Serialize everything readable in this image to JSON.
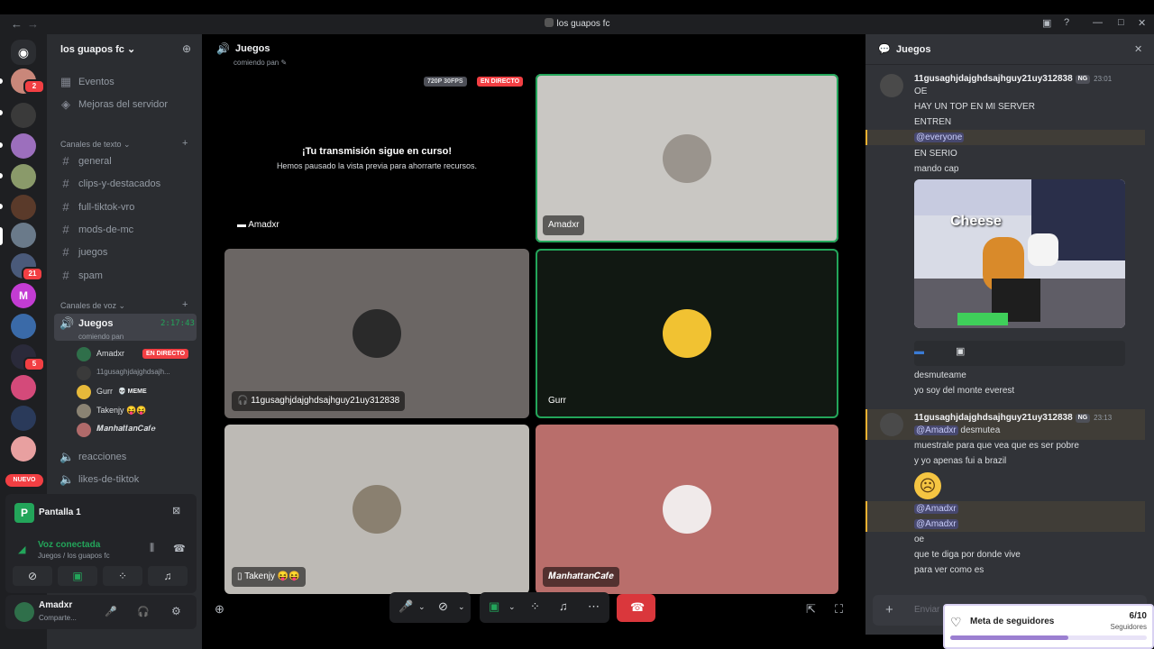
{
  "window": {
    "title": "los guapos fc"
  },
  "rail": {
    "badges": [
      "2",
      "21",
      "5"
    ],
    "nuevo_label": "NUEVO"
  },
  "sidebar": {
    "server_name": "los guapos fc",
    "top_items": [
      {
        "label": "Eventos",
        "icon": "calendar-icon"
      },
      {
        "label": "Mejoras del servidor",
        "icon": "boost-icon"
      }
    ],
    "text_category": "Canales de texto",
    "text_channels": [
      "general",
      "clips-y-destacados",
      "full-tiktok-vro",
      "mods-de-mc",
      "juegos",
      "spam"
    ],
    "voice_category": "Canales de voz",
    "active_voice": {
      "name": "Juegos",
      "status": "comiendo pan",
      "timer": "2:17:43"
    },
    "voice_users": [
      {
        "name": "Amadxr",
        "live": "EN DIRECTO",
        "avatar_color": "#2f6f4a"
      },
      {
        "name": "11gusaghjdajghdsajh...",
        "avatar_color": "#3a3a3a"
      },
      {
        "name": "Gurr",
        "badge": "💀 MEME",
        "avatar_color": "#e6b93a"
      },
      {
        "name": "Takenjy 😝😝",
        "avatar_color": "#8a8373"
      },
      {
        "name": "𝑴𝒂𝒏𝒉𝒂𝒕𝒕𝒂𝒏𝑪𝒂𝒇𝒆",
        "avatar_color": "#b06a6a"
      }
    ],
    "other_voice": [
      "reacciones",
      "likes-de-tiktok"
    ]
  },
  "panel": {
    "screen_label": "Pantalla 1",
    "voice_status": "Voz conectada",
    "voice_location": "Juegos / los guapos fc"
  },
  "userbar": {
    "name": "Amadxr",
    "status": "Comparte..."
  },
  "stage": {
    "title": "Juegos",
    "subtitle": "comiendo pan",
    "stream_quality": "720P 30FPS",
    "live_label": "EN DIRECTO",
    "paused_title": "¡Tu transmisión sigue en curso!",
    "paused_sub": "Hemos pausado la vista previa para ahorrarte recursos.",
    "tiles": [
      {
        "name": "Amadxr",
        "kind": "stream",
        "bg": "#000000"
      },
      {
        "name": "Amadxr",
        "kind": "avatar",
        "bg": "#c9c7c3",
        "avatar": "#9a948d",
        "speaking": true
      },
      {
        "name": "11gusaghjdajghdsajhguy21uy312838",
        "kind": "avatar",
        "bg": "#6b6664",
        "avatar": "#2a2a2a"
      },
      {
        "name": "Gurr",
        "kind": "avatar",
        "bg": "#111812",
        "avatar": "#f1c232",
        "speaking": true
      },
      {
        "name": "Takenjy 😝😝",
        "kind": "avatar",
        "bg": "#bdbab5",
        "avatar": "#8a8070"
      },
      {
        "name": "𝑴𝒂𝒏𝒉𝒂𝒕𝒕𝒂𝒏𝑪𝒂𝒇𝒆",
        "kind": "avatar",
        "bg": "#b96e6b",
        "avatar": "#f0eaea"
      }
    ]
  },
  "chat": {
    "title": "Juegos",
    "msg1": {
      "author": "11gusaghjdajghdsajhguy21uy312838",
      "tag": "NG",
      "time": "23:01",
      "lines": [
        "OE",
        "HAY UN TOP EN MI SERVER",
        "ENTREN"
      ],
      "mention": "@everyone",
      "lines2": [
        "EN SERIO",
        "mando cap"
      ]
    },
    "image_caption": "Cheese",
    "lines3": [
      "desmuteame",
      "yo soy del monte everest"
    ],
    "msg2": {
      "author": "11gusaghjdajghdsajhguy21uy312838",
      "tag": "NG",
      "time": "23:13",
      "mention": "@Amadxr",
      "mention_text": "desmutea",
      "lines": [
        "muestrale para que vea que es ser pobre",
        "y yo apenas fui a brazil"
      ]
    },
    "mentions2": [
      "@Amadxr",
      "@Amadxr"
    ],
    "lines4": [
      "oe",
      "que te diga por donde vive",
      "para ver como es"
    ],
    "input_placeholder": "Enviar"
  },
  "goal": {
    "title": "Meta de seguidores",
    "count": "6/10",
    "unit": "Seguidores",
    "progress": 0.6
  }
}
